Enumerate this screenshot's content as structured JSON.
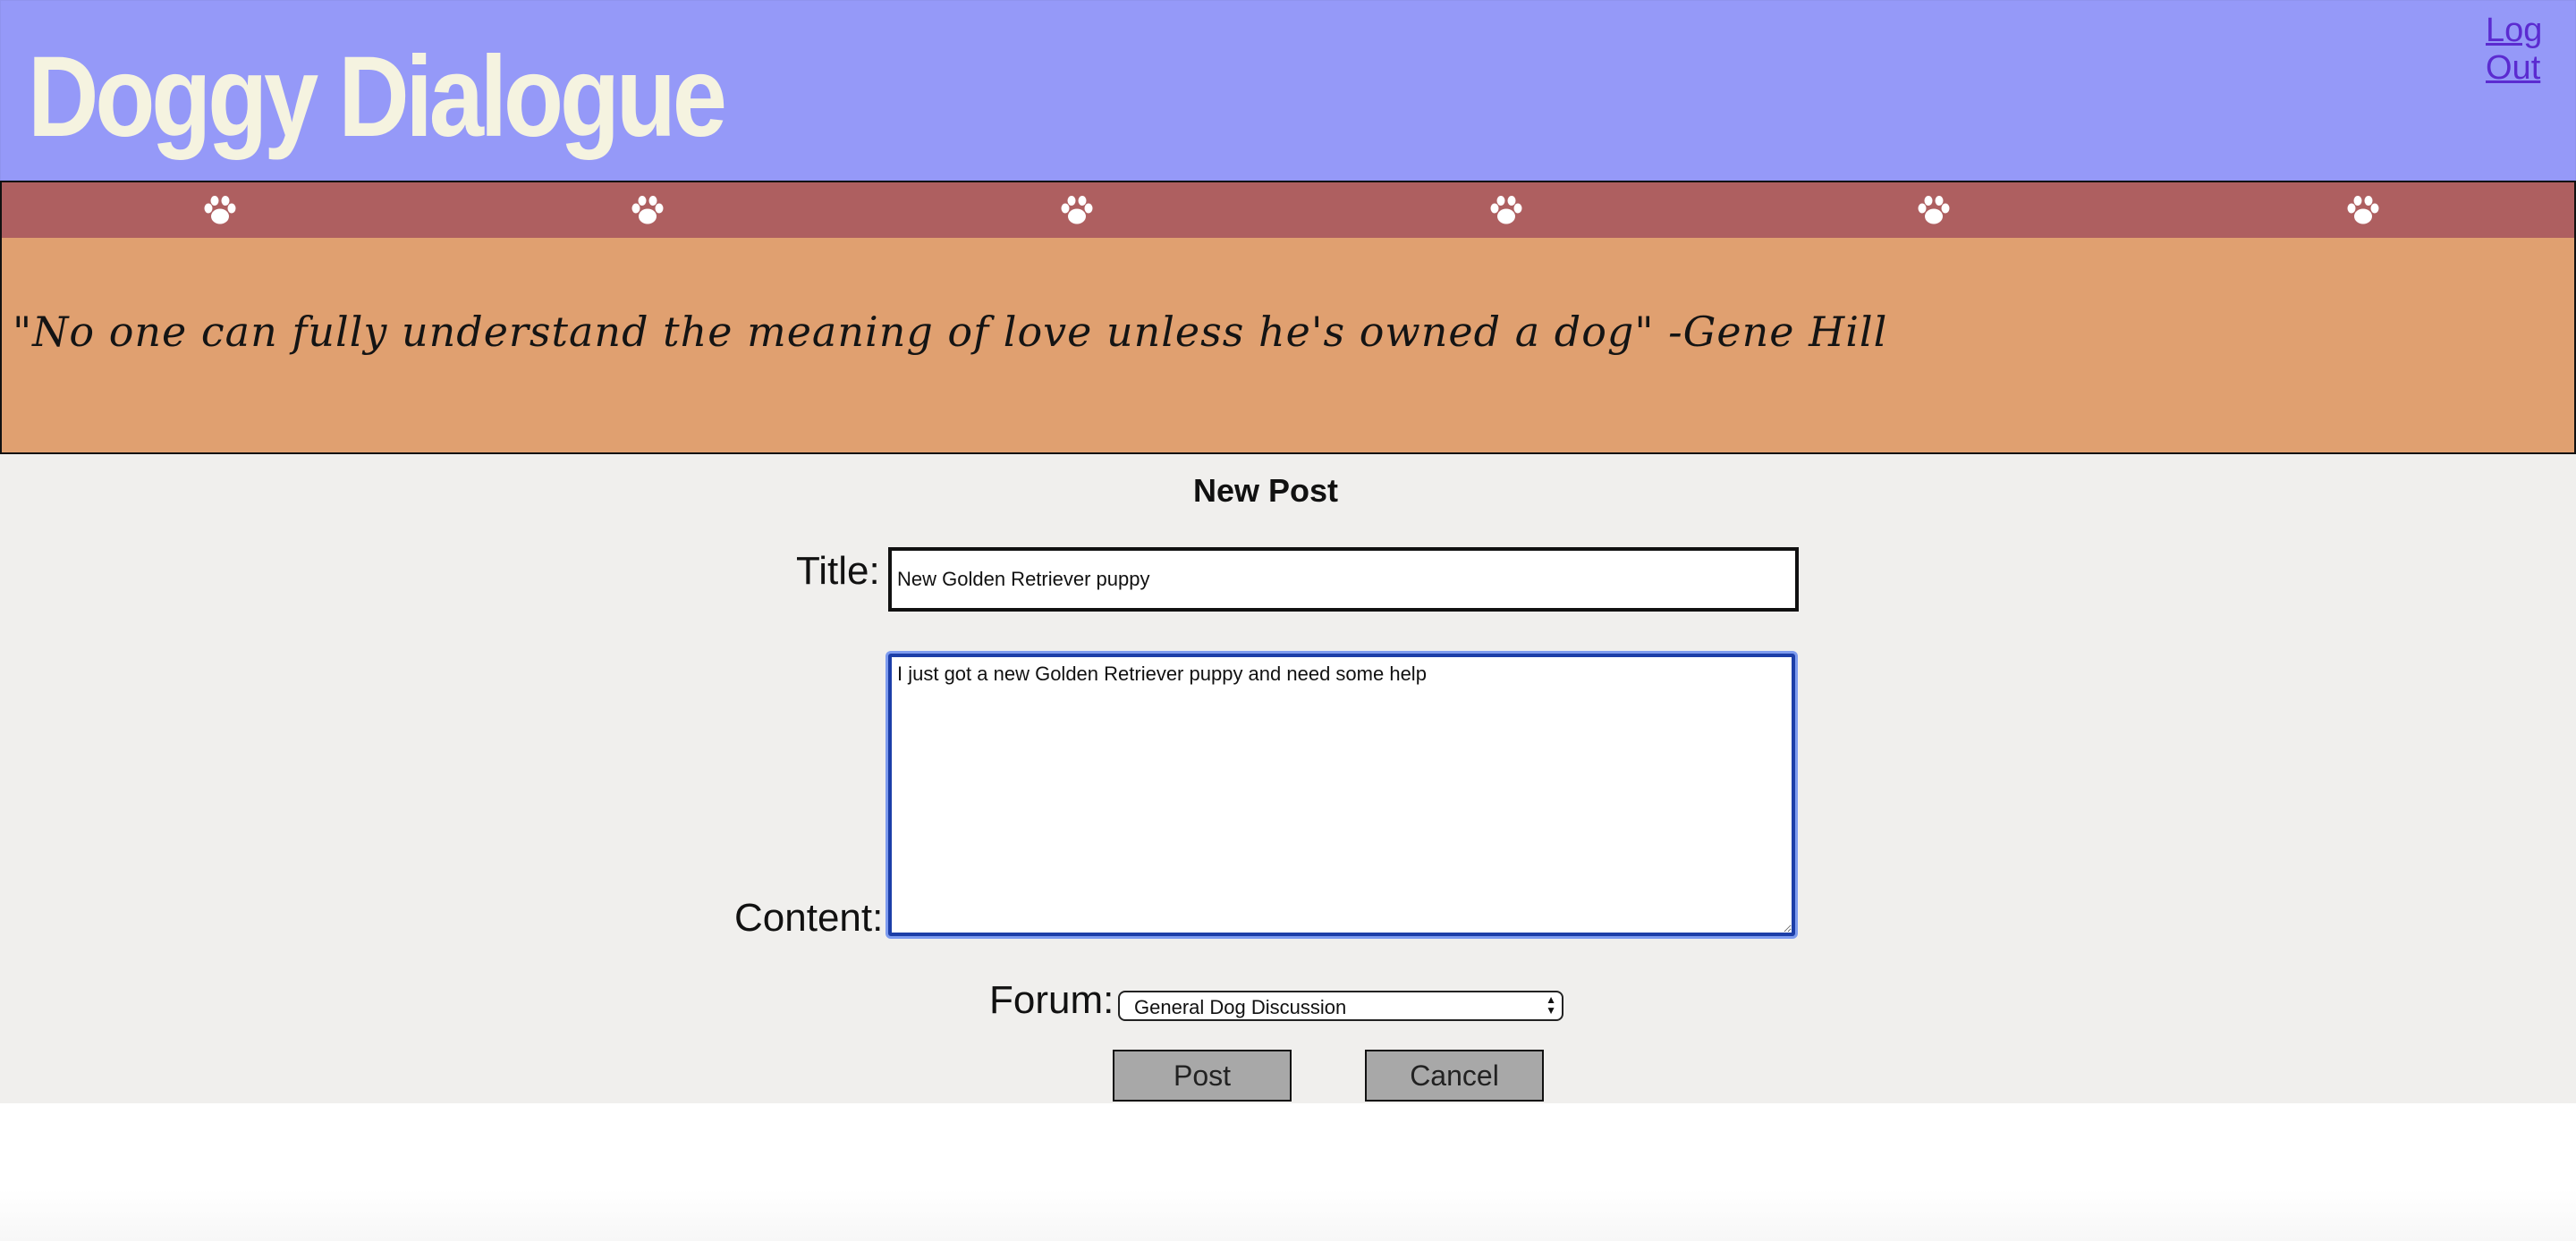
{
  "header": {
    "site_title": "Doggy Dialogue",
    "logout_label": "Log Out",
    "background_color": "#9599f8"
  },
  "paw_strip": {
    "icon": "paw-print-icon",
    "count": 6,
    "background_color": "#ae5f60"
  },
  "quote": {
    "text": "\"No one can fully understand the meaning of love unless he's owned a dog\" -Gene Hill",
    "background_color": "#e0a070"
  },
  "form": {
    "heading": "New Post",
    "title_label": "Title:",
    "title_value": "New Golden Retriever puppy",
    "content_label": "Content:",
    "content_value": "I just got a new Golden Retriever puppy and need some help",
    "forum_label": "Forum:",
    "forum_selected": "General Dog Discussion",
    "post_button": "Post",
    "cancel_button": "Cancel"
  }
}
